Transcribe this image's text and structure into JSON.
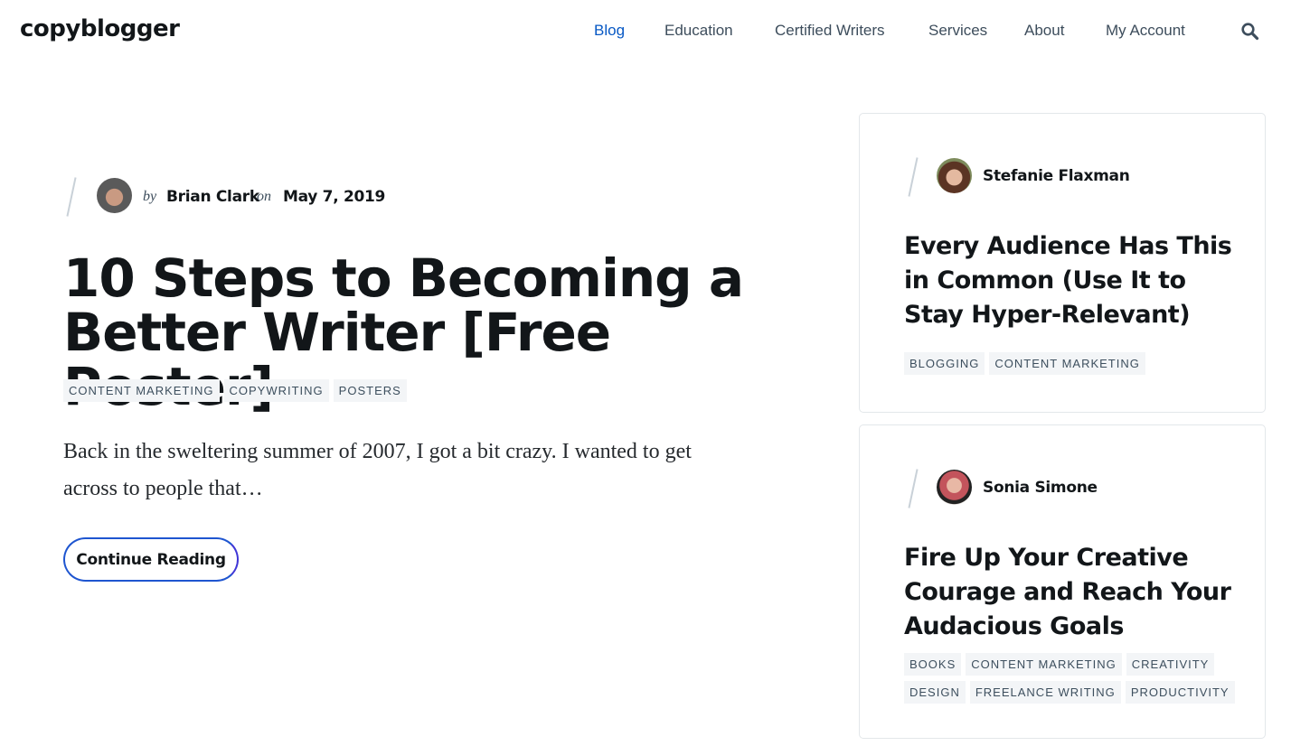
{
  "header": {
    "logo": "copyblogger",
    "nav": [
      {
        "label": "Blog",
        "active": true
      },
      {
        "label": "Education",
        "active": false
      },
      {
        "label": "Certified Writers",
        "active": false
      },
      {
        "label": "Services",
        "active": false
      },
      {
        "label": "About",
        "active": false
      },
      {
        "label": "My Account",
        "active": false
      }
    ],
    "search_icon": "search-icon"
  },
  "colors": {
    "accent": "#0758c4",
    "text": "#121619",
    "nav_text": "#3d4d5c",
    "tag_bg": "#f3f5f7",
    "button_border": "#1e55d0"
  },
  "featured": {
    "by_word": "by",
    "author": "Brian Clark",
    "on_word": "on",
    "date": "May 7, 2019",
    "title": "10 Steps to Becoming a Better Writer [Free Poster]",
    "tags": [
      "Content Marketing",
      "Copywriting",
      "Posters"
    ],
    "excerpt": "Back in the sweltering summer of 2007, I got a bit crazy. I wanted to get across to people that…",
    "button_label": "Continue Reading"
  },
  "sidebar": {
    "cards": [
      {
        "author": "Stefanie Flaxman",
        "title": "Every Audience Has This in Common (Use It to Stay Hyper-Relevant)",
        "tags": [
          "Blogging",
          "Content Marketing"
        ]
      },
      {
        "author": "Sonia Simone",
        "title": "Fire Up Your Creative Courage and Reach Your Audacious Goals",
        "tags": [
          "Books",
          "Content Marketing",
          "Creativity",
          "Design",
          "Freelance Writing",
          "Productivity"
        ]
      }
    ]
  }
}
